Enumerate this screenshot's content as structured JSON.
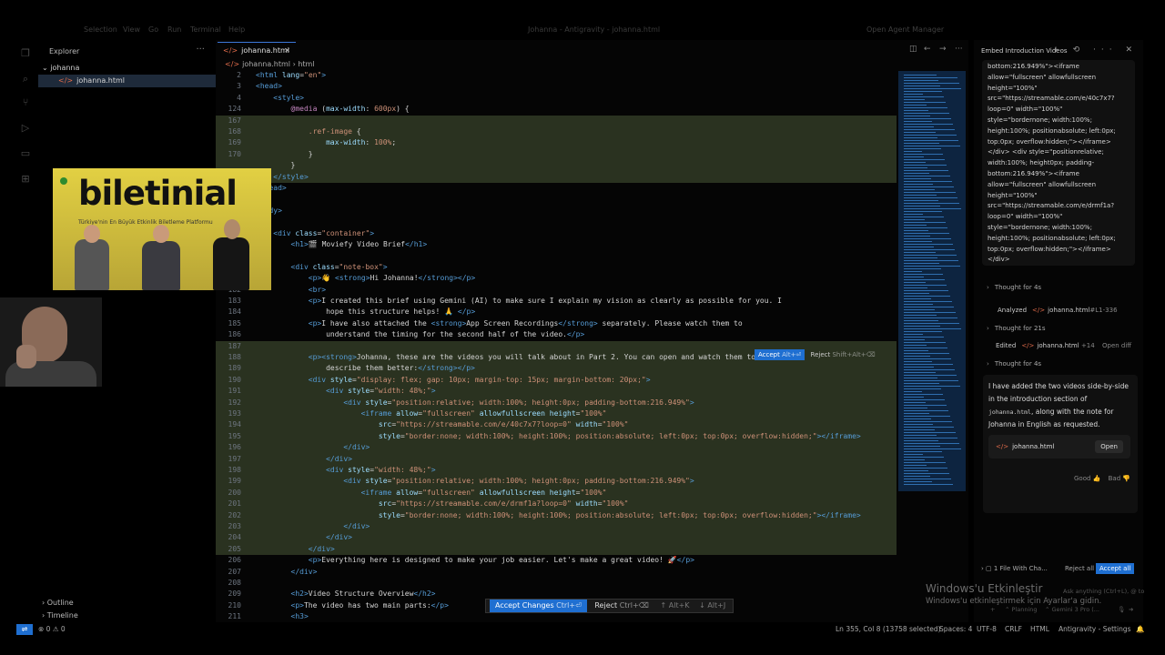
{
  "menu": [
    "Selection",
    "View",
    "Go",
    "Run",
    "Terminal",
    "Help"
  ],
  "window_title": "Johanna - Antigravity - johanna.html",
  "agent_manager": "Open Agent Manager",
  "sidebar": {
    "title": "Explorer",
    "folder": "johanna",
    "file": "johanna.html",
    "outline": "Outline",
    "timeline": "Timeline"
  },
  "editor": {
    "tab": "johanna.html",
    "breadcrumb_file": "johanna.html",
    "breadcrumb_node": "html",
    "inline_accept": "Accept",
    "inline_accept_key": "Alt+⏎",
    "inline_reject": "Reject",
    "inline_reject_key": "Shift+Alt+⌫",
    "bottom_accept": "Accept Changes",
    "bottom_accept_key": "Ctrl+⏎",
    "bottom_reject": "Reject",
    "bottom_reject_key": "Ctrl+⌫",
    "nav_up": "↑ Alt+K",
    "nav_down": "↓ Alt+J",
    "lines": [
      {
        "n": "2",
        "html": "<span class='t-tag'>&lt;html</span> <span class='t-attr'>lang</span>=<span class='t-str'>\"en\"</span><span class='t-tag'>&gt;</span>",
        "cls": "sticky"
      },
      {
        "n": "3",
        "html": "<span class='t-tag'>&lt;head&gt;</span>",
        "cls": "sticky"
      },
      {
        "n": "4",
        "html": "    <span class='t-tag'>&lt;style&gt;</span>",
        "cls": "sticky"
      },
      {
        "n": "124",
        "html": "        <span class='t-kw'>@media</span> (<span class='t-attr'>max-width</span>: <span class='t-str'>600px</span>) {",
        "cls": "sticky"
      },
      {
        "n": "167",
        "html": "",
        "cls": "added"
      },
      {
        "n": "168",
        "html": "            <span class='t-str'>.ref-image</span> {",
        "cls": "added"
      },
      {
        "n": "169",
        "html": "                <span class='t-attr'>max-width</span>: <span class='t-str'>100%</span>;",
        "cls": "added"
      },
      {
        "n": "170",
        "html": "            }",
        "cls": "added"
      },
      {
        "n": "",
        "html": "        }",
        "cls": "added"
      },
      {
        "n": "",
        "html": "    <span class='t-tag'>&lt;/style&gt;</span>",
        "cls": "added"
      },
      {
        "n": "",
        "html": "<span class='t-tag'>&lt;/head&gt;</span>",
        "cls": ""
      },
      {
        "n": "",
        "html": "",
        "cls": ""
      },
      {
        "n": "",
        "html": "<span class='t-tag'>&lt;body&gt;</span>",
        "cls": ""
      },
      {
        "n": "",
        "html": "",
        "cls": ""
      },
      {
        "n": "",
        "html": "    <span class='t-tag'>&lt;div</span> <span class='t-attr'>class</span>=<span class='t-str'>\"container\"</span><span class='t-tag'>&gt;</span>",
        "cls": ""
      },
      {
        "n": "",
        "html": "        <span class='t-tag'>&lt;h1&gt;</span>🎬 Moviefy Video Brief<span class='t-tag'>&lt;/h1&gt;</span>",
        "cls": ""
      },
      {
        "n": "",
        "html": "",
        "cls": ""
      },
      {
        "n": "",
        "html": "        <span class='t-tag'>&lt;div</span> <span class='t-attr'>class</span>=<span class='t-str'>\"note-box\"</span><span class='t-tag'>&gt;</span>",
        "cls": ""
      },
      {
        "n": "",
        "html": "            <span class='t-tag'>&lt;p&gt;</span>👋 <span class='t-tag'>&lt;strong&gt;</span>Hi Johanna!<span class='t-tag'>&lt;/strong&gt;&lt;/p&gt;</span>",
        "cls": ""
      },
      {
        "n": "182",
        "html": "            <span class='t-tag'>&lt;br&gt;</span>",
        "cls": ""
      },
      {
        "n": "183",
        "html": "            <span class='t-tag'>&lt;p&gt;</span>I created this brief using Gemini (AI) to make sure I explain my vision as clearly as possible for you. I",
        "cls": ""
      },
      {
        "n": "184",
        "html": "                hope this structure helps! 🙏 <span class='t-tag'>&lt;/p&gt;</span>",
        "cls": ""
      },
      {
        "n": "185",
        "html": "            <span class='t-tag'>&lt;p&gt;</span>I have also attached the <span class='t-tag'>&lt;strong&gt;</span>App Screen Recordings<span class='t-tag'>&lt;/strong&gt;</span> separately. Please watch them to",
        "cls": ""
      },
      {
        "n": "186",
        "html": "                understand the timing for the second half of the video.<span class='t-tag'>&lt;/p&gt;</span>",
        "cls": ""
      },
      {
        "n": "187",
        "html": "",
        "cls": "added"
      },
      {
        "n": "188",
        "html": "            <span class='t-tag'>&lt;p&gt;&lt;strong&gt;</span>Johanna, these are the videos you will talk about in Part 2. You can open and watch them to",
        "cls": "added"
      },
      {
        "n": "189",
        "html": "                describe them better:<span class='t-tag'>&lt;/strong&gt;&lt;/p&gt;</span>",
        "cls": "added"
      },
      {
        "n": "190",
        "html": "            <span class='t-tag'>&lt;div</span> <span class='t-attr'>style</span>=<span class='t-str'>\"display: flex; gap: 10px; margin-top: 15px; margin-bottom: 20px;\"</span><span class='t-tag'>&gt;</span>",
        "cls": "added"
      },
      {
        "n": "191",
        "html": "                <span class='t-tag'>&lt;div</span> <span class='t-attr'>style</span>=<span class='t-str'>\"width: 48%;\"</span><span class='t-tag'>&gt;</span>",
        "cls": "added"
      },
      {
        "n": "192",
        "html": "                    <span class='t-tag'>&lt;div</span> <span class='t-attr'>style</span>=<span class='t-str'>\"position:relative; width:100%; height:0px; padding-bottom:216.949%\"</span><span class='t-tag'>&gt;</span>",
        "cls": "added"
      },
      {
        "n": "193",
        "html": "                        <span class='t-tag'>&lt;iframe</span> <span class='t-attr'>allow</span>=<span class='t-str'>\"fullscreen\"</span> <span class='t-attr'>allowfullscreen</span> <span class='t-attr'>height</span>=<span class='t-str'>\"100%\"</span>",
        "cls": "added"
      },
      {
        "n": "194",
        "html": "                            <span class='t-attr'>src</span>=<span class='t-str'>\"https://streamable.com/e/40c7x7?loop=0\"</span> <span class='t-attr'>width</span>=<span class='t-str'>\"100%\"</span>",
        "cls": "added"
      },
      {
        "n": "195",
        "html": "                            <span class='t-attr'>style</span>=<span class='t-str'>\"border:none; width:100%; height:100%; position:absolute; left:0px; top:0px; overflow:hidden;\"</span><span class='t-tag'>&gt;&lt;/iframe&gt;</span>",
        "cls": "added"
      },
      {
        "n": "196",
        "html": "                    <span class='t-tag'>&lt;/div&gt;</span>",
        "cls": "added"
      },
      {
        "n": "197",
        "html": "                <span class='t-tag'>&lt;/div&gt;</span>",
        "cls": "added"
      },
      {
        "n": "198",
        "html": "                <span class='t-tag'>&lt;div</span> <span class='t-attr'>style</span>=<span class='t-str'>\"width: 48%;\"</span><span class='t-tag'>&gt;</span>",
        "cls": "added"
      },
      {
        "n": "199",
        "html": "                    <span class='t-tag'>&lt;div</span> <span class='t-attr'>style</span>=<span class='t-str'>\"position:relative; width:100%; height:0px; padding-bottom:216.949%\"</span><span class='t-tag'>&gt;</span>",
        "cls": "added"
      },
      {
        "n": "200",
        "html": "                        <span class='t-tag'>&lt;iframe</span> <span class='t-attr'>allow</span>=<span class='t-str'>\"fullscreen\"</span> <span class='t-attr'>allowfullscreen</span> <span class='t-attr'>height</span>=<span class='t-str'>\"100%\"</span>",
        "cls": "added"
      },
      {
        "n": "201",
        "html": "                            <span class='t-attr'>src</span>=<span class='t-str'>\"https://streamable.com/e/drmf1a?loop=0\"</span> <span class='t-attr'>width</span>=<span class='t-str'>\"100%\"</span>",
        "cls": "added"
      },
      {
        "n": "202",
        "html": "                            <span class='t-attr'>style</span>=<span class='t-str'>\"border:none; width:100%; height:100%; position:absolute; left:0px; top:0px; overflow:hidden;\"</span><span class='t-tag'>&gt;&lt;/iframe&gt;</span>",
        "cls": "added"
      },
      {
        "n": "203",
        "html": "                    <span class='t-tag'>&lt;/div&gt;</span>",
        "cls": "added"
      },
      {
        "n": "204",
        "html": "                <span class='t-tag'>&lt;/div&gt;</span>",
        "cls": "added"
      },
      {
        "n": "205",
        "html": "            <span class='t-tag'>&lt;/div&gt;</span>",
        "cls": "added"
      },
      {
        "n": "206",
        "html": "            <span class='t-tag'>&lt;p&gt;</span>Everything here is designed to make your job easier. Let's make a great video! 🚀<span class='t-tag'>&lt;/p&gt;</span>",
        "cls": ""
      },
      {
        "n": "207",
        "html": "        <span class='t-tag'>&lt;/div&gt;</span>",
        "cls": ""
      },
      {
        "n": "208",
        "html": "",
        "cls": ""
      },
      {
        "n": "209",
        "html": "        <span class='t-tag'>&lt;h2&gt;</span>Video Structure Overview<span class='t-tag'>&lt;/h2&gt;</span>",
        "cls": ""
      },
      {
        "n": "210",
        "html": "        <span class='t-tag'>&lt;p&gt;</span>The video has two main parts:<span class='t-tag'>&lt;/p&gt;</span>",
        "cls": ""
      },
      {
        "n": "211",
        "html": "        <span class='t-tag'>&lt;h3&gt;</span>",
        "cls": ""
      }
    ]
  },
  "webcam": {
    "logo": "biletinial",
    "tagline": "Türkiye'nin En Büyük Etkinlik Biletleme Platformu"
  },
  "chat": {
    "title": "Embed Introduction Videos",
    "code_lines": [
      "bottom:216.949%\"><iframe",
      "allow=\"fullscreen\" allowfullscreen",
      "height=\"100%\"",
      "src=\"https://streamable.com/e/40c7x7?",
      "loop=0\" width=\"100%\"",
      "style=\"bordernone; width:100%;",
      "height:100%; positionabsolute; left:0px;",
      "top:0px; overflow:hidden;\"></iframe>",
      "</div> <div style=\"positionrelative;",
      "width:100%; height0px; padding-",
      "bottom:216.949%\"><iframe",
      "allow=\"fullscreen\" allowfullscreen",
      "height=\"100%\"",
      "src=\"https://streamable.com/e/drmf1a?",
      "loop=0\" width=\"100%\"",
      "style=\"bordernone; width:100%;",
      "height:100%; positionabsolute; left:0px;",
      "top:0px; overflow:hidden;\"></iframe>",
      "</div>"
    ],
    "thought1": "Thought for 4s",
    "analyzed_label": "Analyzed",
    "analyzed_file": "johanna.html",
    "analyzed_ref": "#L1-336",
    "thought2": "Thought for 21s",
    "edited_label": "Edited",
    "edited_file": "johanna.html",
    "edited_count": "+14",
    "open_diff": "Open diff",
    "thought3": "Thought for 4s",
    "reply_text_1": "I have added the two videos side-by-side in the introduction section of ",
    "reply_mono": "johanna.html",
    "reply_text_2": ", along with the note for Johanna in English as requested.",
    "card_file": "johanna.html",
    "card_open": "Open",
    "good": "Good",
    "bad": "Bad",
    "files_changed": "1 File With Cha...",
    "reject_all": "Reject all",
    "accept_all": "Accept all",
    "composer_hint": "Ask anything (Ctrl+L), @ to mention, / for workflows",
    "planning": "Planning",
    "model": "Gemini 3 Pro (..."
  },
  "watermark": {
    "line1": "Windows'u Etkinleştir",
    "line2": "Windows'u etkinleştirmek için Ayarlar'a gidin."
  },
  "status": {
    "problems": "⊗ 0 ⚠ 0",
    "cursor": "Ln 355, Col 8 (13758 selected)",
    "spaces": "Spaces: 4",
    "encoding": "UTF-8",
    "eol": "CRLF",
    "language": "HTML",
    "settings": "Antigravity - Settings"
  }
}
